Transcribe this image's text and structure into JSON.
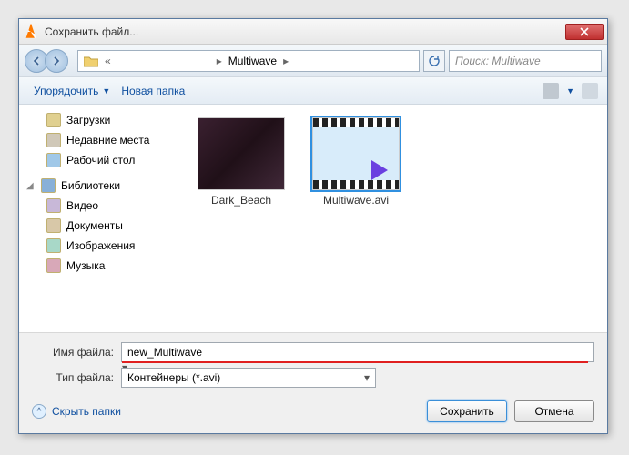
{
  "window": {
    "title": "Сохранить файл..."
  },
  "nav": {
    "path_segments": [
      "«",
      "",
      "Multiwave"
    ],
    "search_placeholder": "Поиск: Multiwave"
  },
  "toolbar": {
    "organize_label": "Упорядочить",
    "new_folder_label": "Новая папка"
  },
  "tree": {
    "favorites": [
      "Загрузки",
      "Недавние места",
      "Рабочий стол"
    ],
    "libraries_label": "Библиотеки",
    "libraries": [
      "Видео",
      "Документы",
      "Изображения",
      "Музыка"
    ]
  },
  "content": {
    "items": [
      {
        "name": "Dark_Beach",
        "type": "folder",
        "selected": false
      },
      {
        "name": "Multiwave.avi",
        "type": "video",
        "selected": true
      }
    ]
  },
  "footer": {
    "filename_label": "Имя файла:",
    "filename_value": "new_Multiwave",
    "filetype_label": "Тип файла:",
    "filetype_value": "Контейнеры (*.avi)",
    "hide_folders_label": "Скрыть папки",
    "save_label": "Сохранить",
    "cancel_label": "Отмена"
  }
}
